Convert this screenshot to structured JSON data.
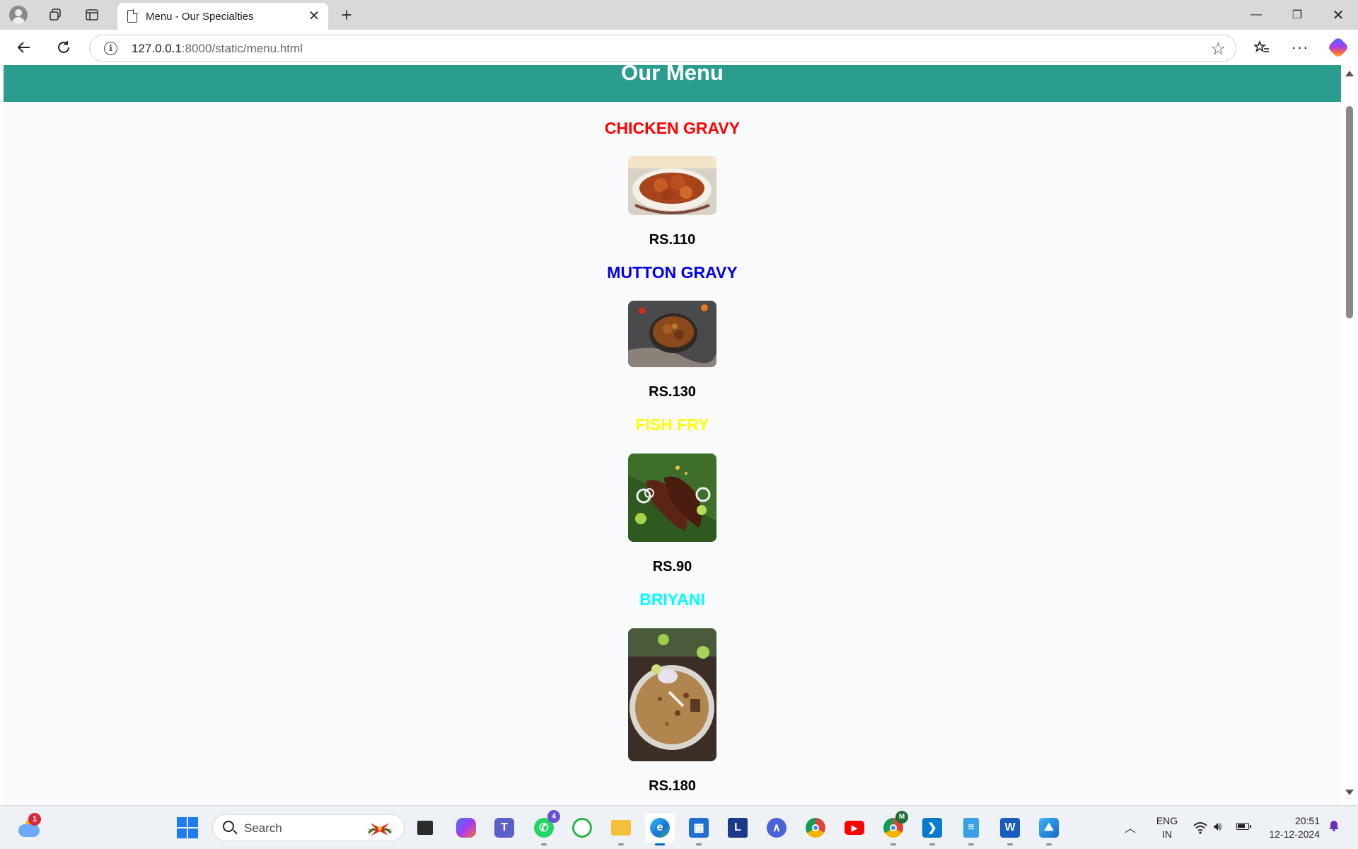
{
  "browser": {
    "tab_title": "Menu - Our Specialties",
    "tab_close": "✕",
    "new_tab": "+",
    "url_host": "127.0.0.1",
    "url_rest": ":8000/static/menu.html",
    "window_controls": {
      "minimize": "—",
      "restore": "❐",
      "close": "✕"
    }
  },
  "page": {
    "heading": "Our Menu",
    "header_color": "#2a9d8f",
    "dishes": [
      {
        "name": "CHICKEN GRAVY",
        "price": "RS.110",
        "color": "#ff0000",
        "image": "chicken-gravy-photo"
      },
      {
        "name": "MUTTON GRAVY",
        "price": "RS.130",
        "color": "#0000ee",
        "image": "mutton-gravy-photo"
      },
      {
        "name": "FISH FRY",
        "price": "RS.90",
        "color": "#ffff00",
        "image": "fish-fry-photo"
      },
      {
        "name": "BRIYANI",
        "price": "RS.180",
        "color": "#00ffff",
        "image": "briyani-photo"
      }
    ]
  },
  "taskbar": {
    "weather_badge": "1",
    "search_label": "Search",
    "whatsapp_badge": "4",
    "chrome_profile_badge": "M",
    "language_line1": "ENG",
    "language_line2": "IN",
    "time": "20:51",
    "date": "12-12-2024",
    "apps": [
      "task-view",
      "copilot",
      "teams",
      "whatsapp",
      "spotify-like-app",
      "file-explorer",
      "edge",
      "microsoft-store",
      "l-app",
      "vector-app",
      "chrome",
      "youtube",
      "chrome-profile",
      "vs-code",
      "notepad",
      "word",
      "photos"
    ]
  }
}
